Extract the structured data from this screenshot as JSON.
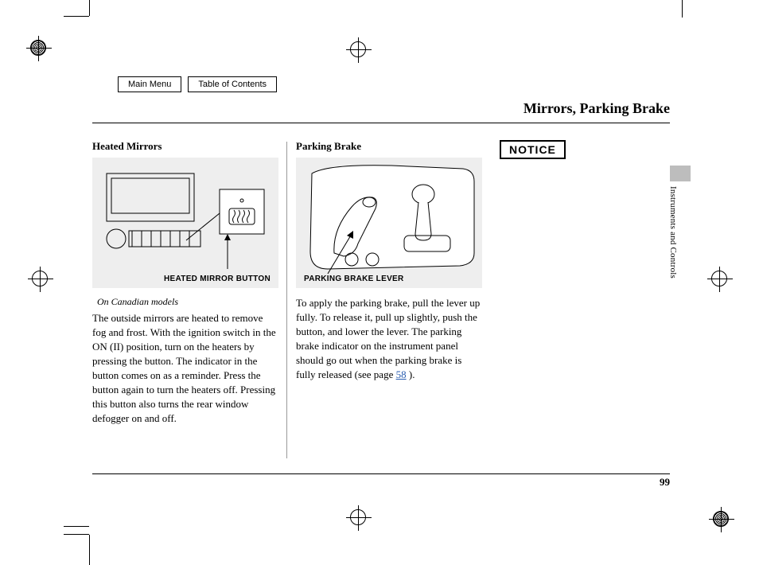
{
  "nav": {
    "main_menu": "Main Menu",
    "toc": "Table of Contents"
  },
  "page_title": "Mirrors, Parking Brake",
  "section_label": "Instruments and Controls",
  "page_number": "99",
  "col1": {
    "heading": "Heated Mirrors",
    "figure_caption": "HEATED MIRROR BUTTON",
    "note": "On Canadian models",
    "body": "The outside mirrors are heated to remove fog and frost. With the ignition switch in the ON (II) position, turn on the heaters by pressing the button. The indicator in the button comes on as a reminder. Press the button again to turn the heaters off. Pressing this button also turns the rear window defogger on and off."
  },
  "col2": {
    "heading": "Parking Brake",
    "figure_caption": "PARKING BRAKE LEVER",
    "body_before_link": "To apply the parking brake, pull the lever up fully. To release it, pull up slightly, push the button, and lower the lever. The parking brake indicator on the instrument panel should go out when the parking brake is fully released (see page ",
    "link_text": "58",
    "body_after_link": " )."
  },
  "col3": {
    "notice": "NOTICE"
  }
}
